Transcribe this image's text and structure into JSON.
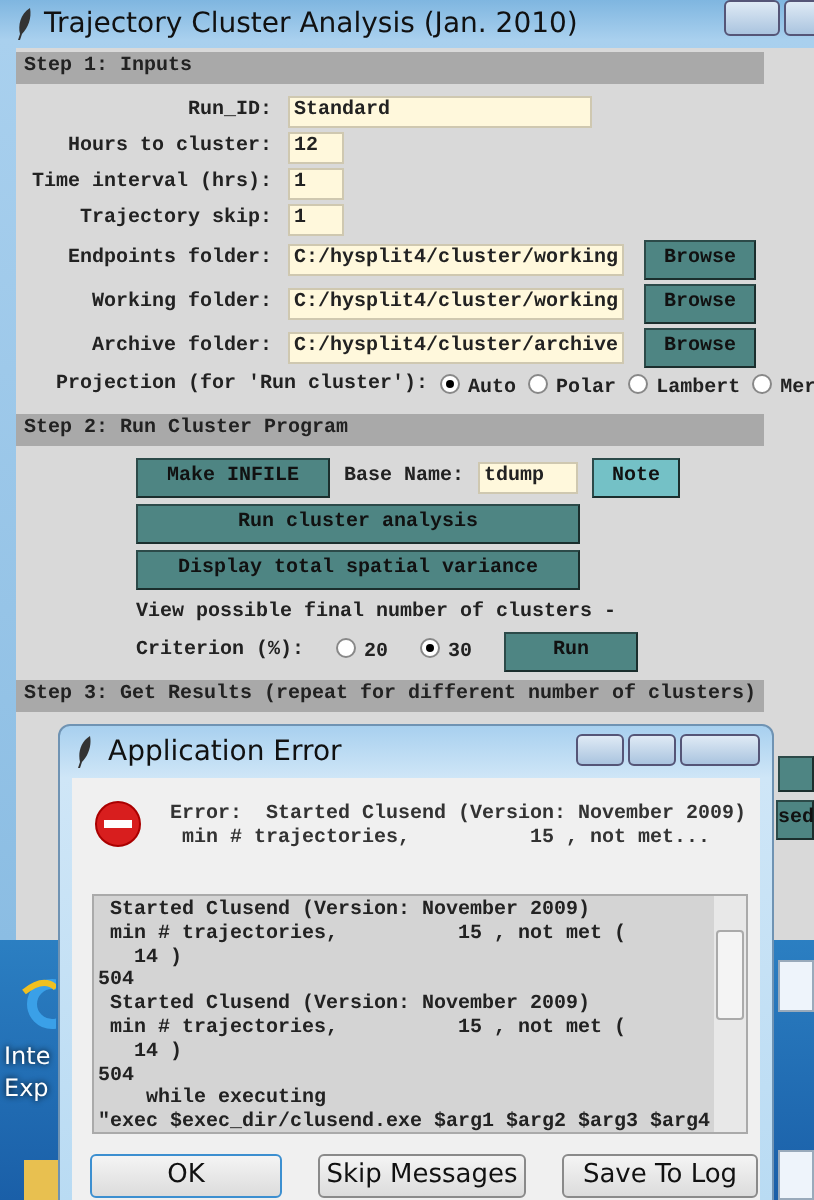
{
  "window": {
    "title": "Trajectory Cluster Analysis (Jan. 2010)"
  },
  "step1": {
    "header": "Step 1: Inputs",
    "fields": [
      {
        "label": "Run_ID:",
        "value": "Standard",
        "kind": "wide"
      },
      {
        "label": "Hours to cluster:",
        "value": "12",
        "kind": "short"
      },
      {
        "label": "Time interval (hrs):",
        "value": "1",
        "kind": "short"
      },
      {
        "label": "Trajectory skip:",
        "value": "1",
        "kind": "short"
      },
      {
        "label": "Endpoints folder:",
        "value": "C:/hysplit4/cluster/working",
        "kind": "folder",
        "button": "Browse"
      },
      {
        "label": "Working folder:",
        "value": "C:/hysplit4/cluster/working",
        "kind": "folder",
        "button": "Browse"
      },
      {
        "label": "Archive folder:",
        "value": "C:/hysplit4/cluster/archive",
        "kind": "folder",
        "button": "Browse"
      }
    ],
    "projection": {
      "label": "Projection (for 'Run cluster'):",
      "options": [
        {
          "label": "Auto",
          "selected": true
        },
        {
          "label": "Polar",
          "selected": false
        },
        {
          "label": "Lambert",
          "selected": false
        },
        {
          "label": "Mer",
          "selected": false
        }
      ]
    }
  },
  "step2": {
    "header": "Step 2: Run Cluster Program",
    "make_infile": "Make INFILE",
    "base_name": {
      "label": "Base Name:",
      "value": "tdump"
    },
    "note": "Note",
    "run_cluster": "Run cluster analysis",
    "display_variance": "Display total spatial variance",
    "view_text": "View possible final number of clusters -",
    "criterion": {
      "label": "Criterion (%):",
      "options": [
        {
          "label": "20",
          "selected": false
        },
        {
          "label": "30",
          "selected": true
        }
      ]
    },
    "run": "Run"
  },
  "step3": {
    "header": "Step 3: Get Results (repeat for different number of clusters)",
    "obscured_button": "sed"
  },
  "desktop": {
    "icon_label": [
      "Inte",
      "Exp"
    ]
  },
  "dialog": {
    "title": "Application Error",
    "message": [
      "Error:  Started Clusend (Version: November 2009)",
      " min # trajectories,          15 , not met..."
    ],
    "log": [
      " Started Clusend (Version: November 2009)",
      " min # trajectories,          15 , not met (",
      "   14 )",
      "504",
      " Started Clusend (Version: November 2009)",
      " min # trajectories,          15 , not met (",
      "   14 )",
      "504",
      "    while executing",
      "\"exec $exec_dir/clusend.exe $arg1 $arg2 $arg3 $arg4"
    ],
    "buttons": [
      "OK",
      "Skip Messages",
      "Save To Log"
    ]
  }
}
